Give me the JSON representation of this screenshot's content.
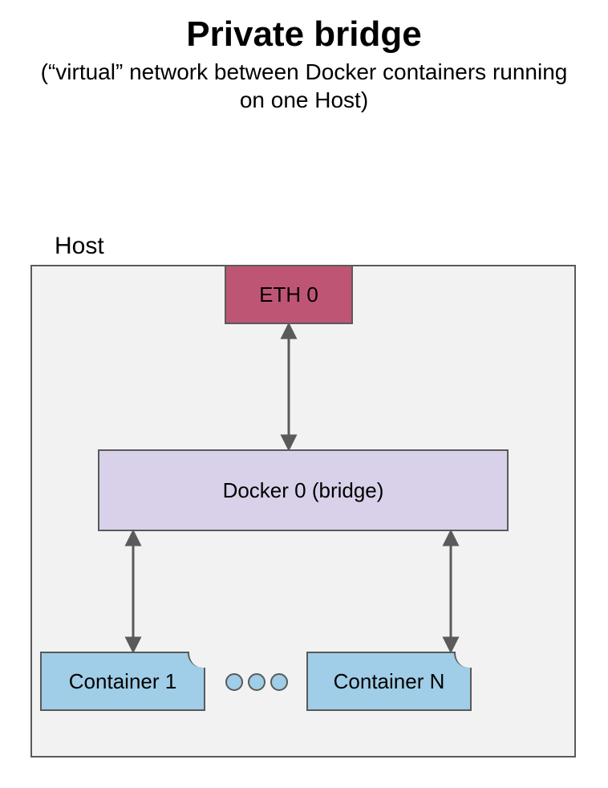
{
  "title": "Private bridge",
  "subtitle": "(“virtual” network between Docker containers running on one Host)",
  "host_label": "Host",
  "nodes": {
    "eth": "ETH 0",
    "bridge": "Docker 0 (bridge)",
    "container_first": "Container 1",
    "container_last": "Container N"
  },
  "colors": {
    "eth_bg": "#bf5575",
    "bridge_bg": "#d8d1e9",
    "container_bg": "#a0cde7",
    "host_bg": "#f2f2f2",
    "border": "#5a5a5a"
  },
  "connections": [
    {
      "from": "eth",
      "to": "bridge",
      "bidirectional": true
    },
    {
      "from": "bridge",
      "to": "container_first",
      "bidirectional": true
    },
    {
      "from": "bridge",
      "to": "container_last",
      "bidirectional": true
    }
  ]
}
